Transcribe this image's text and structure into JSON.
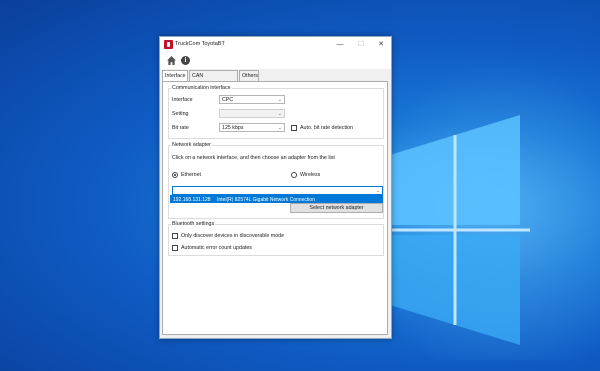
{
  "window": {
    "title": "TruckCom ToyotaBT"
  },
  "toolbar": {
    "home_icon": "home-icon",
    "info_icon": "info-icon"
  },
  "tabs": [
    {
      "label": "Interface",
      "active": true
    },
    {
      "label": "CAN Communication",
      "active": false
    },
    {
      "label": "Others",
      "active": false
    }
  ],
  "communication": {
    "title": "Communication interface",
    "interface_label": "Interface",
    "interface_value": "CPC",
    "setting_label": "Setting",
    "setting_value": "",
    "bitrate_label": "Bit rate",
    "bitrate_value": "125 kbps",
    "auto_bitrate_label": "Auto. bit rate detection",
    "auto_bitrate_checked": false
  },
  "network": {
    "title": "Network adapter",
    "instruction": "Click on a network interface, and then choose an adapter from the list",
    "ethernet_label": "Ethernet",
    "ethernet_selected": true,
    "wireless_label": "Wireless",
    "wireless_selected": false,
    "adapter_value": "",
    "dropdown_option_ip": "192.168.131.128",
    "dropdown_option_name": "Intel(R) 82574L Gigabit Network Connection",
    "select_button": "Select network adapter"
  },
  "bluetooth": {
    "title": "Bluetooth settings",
    "discoverable_label": "Only discover devices in discoverable mode",
    "discoverable_checked": false,
    "error_count_label": "Automatic error count updates",
    "error_count_checked": false
  },
  "colors": {
    "accent": "#0078d7",
    "brand": "#c0142c"
  }
}
